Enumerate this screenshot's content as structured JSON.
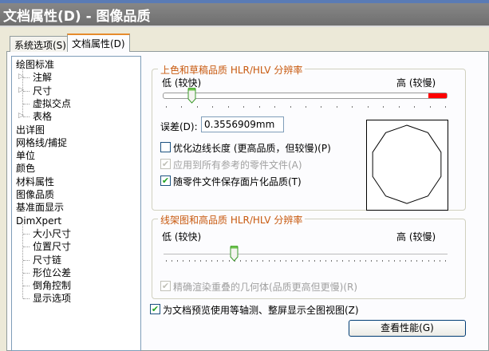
{
  "window": {
    "title": "文档属性(D) - 图像品质"
  },
  "tabs": [
    {
      "label": "系统选项(S)"
    },
    {
      "label": "文档属性(D)"
    }
  ],
  "tree": [
    "绘图标准",
    "注解",
    "尺寸",
    "虚拟交点",
    "表格",
    "出详图",
    "网格线/捕捉",
    "单位",
    "颜色",
    "材料属性",
    "图像品质",
    "基准面显示",
    "DimXpert",
    "大小尺寸",
    "位置尺寸",
    "尺寸链",
    "形位公差",
    "倒角控制",
    "显示选项"
  ],
  "shaded": {
    "title": "上色和草稿品质 HLR/HLV 分辨率",
    "low": "低 (较快)",
    "high": "高 (较慢)",
    "slider_value": 0.1,
    "error_label": "误差(D):",
    "error_value": "0.3556909mm",
    "optimize": "优化边线长度 (更高品质，但较慢)(P)",
    "optimize_checked": false,
    "apply_all": "应用到所有参考的零件文件(A)",
    "apply_all_checked": true,
    "save_tess": "随零件文件保存面片化品质(T)",
    "save_tess_checked": true
  },
  "wireframe": {
    "title": "线架图和高品质 HLR/HLV 分辨率",
    "low": "低 (较快)",
    "high": "高 (较慢)",
    "slider_value": 0.25,
    "precise": "精确渲染重叠的几何体(品质更高但更慢)(R)",
    "precise_checked": true
  },
  "preview_iso": "为文档预览使用等轴测、整屏显示全图视图(Z)",
  "preview_iso_checked": true,
  "perf_button": "查看性能(G)"
}
